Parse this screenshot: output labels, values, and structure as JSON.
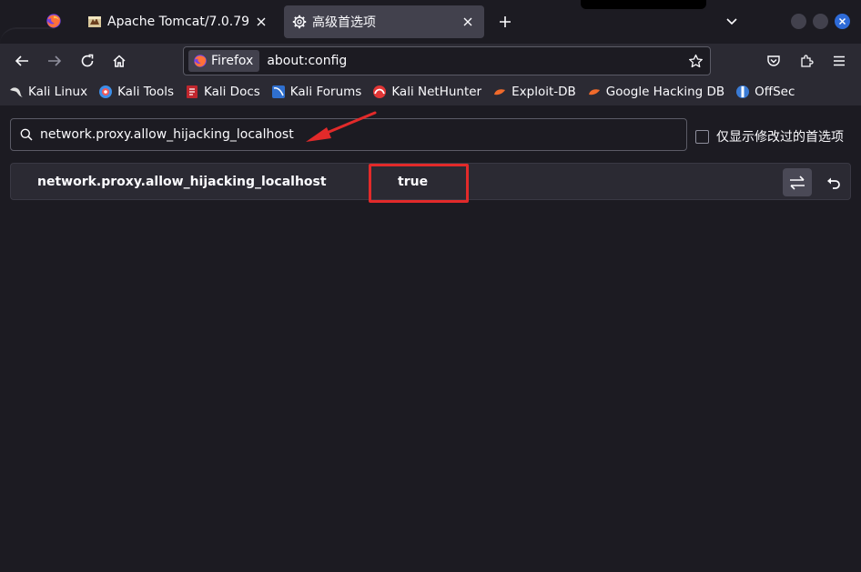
{
  "tabs": [
    {
      "label": "Apache Tomcat/7.0.79",
      "icon": "tomcat-icon"
    },
    {
      "label": "高级首选项",
      "icon": "gear-icon",
      "active": true
    }
  ],
  "nav": {
    "identity_label": "Firefox",
    "url": "about:config"
  },
  "bookmarks": [
    {
      "label": "Kali Linux",
      "icon": "kali-dragon-icon"
    },
    {
      "label": "Kali Tools",
      "icon": "kali-tools-icon"
    },
    {
      "label": "Kali Docs",
      "icon": "kali-docs-icon"
    },
    {
      "label": "Kali Forums",
      "icon": "kali-forums-icon"
    },
    {
      "label": "Kali NetHunter",
      "icon": "nethunter-icon"
    },
    {
      "label": "Exploit-DB",
      "icon": "exploit-db-icon"
    },
    {
      "label": "Google Hacking DB",
      "icon": "ghdb-icon"
    },
    {
      "label": "OffSec",
      "icon": "offsec-icon"
    }
  ],
  "config": {
    "search_value": "network.proxy.allow_hijacking_localhost",
    "modified_only_label": "仅显示修改过的首选项",
    "pref": {
      "name": "network.proxy.allow_hijacking_localhost",
      "value": "true"
    }
  },
  "colors": {
    "background": "#1c1b22",
    "toolbar": "#2b2a33",
    "annotation": "#e22a2a"
  }
}
